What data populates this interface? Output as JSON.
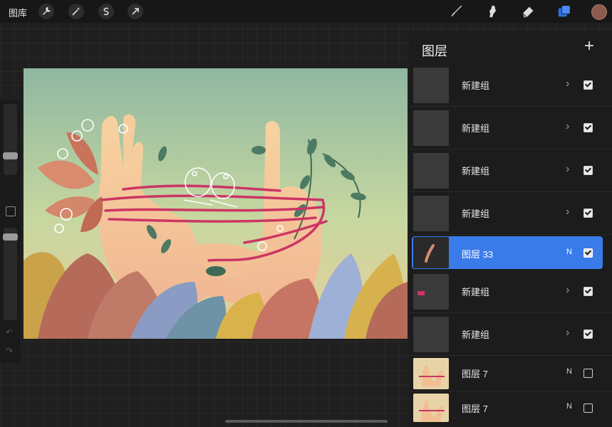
{
  "toolbar": {
    "gallery_label": "图库",
    "left_tools": [
      "wrench-icon",
      "magic-wand-icon",
      "selection-icon",
      "transform-arrow-icon"
    ],
    "right_tools": [
      "brush-icon",
      "smudge-icon",
      "eraser-icon",
      "layers-icon"
    ],
    "active_color": "#8c5a4e",
    "layers_accent": "#3a7bea"
  },
  "layers_panel": {
    "title": "图层",
    "add_label": "+",
    "items": [
      {
        "name": "新建组",
        "kind": "group",
        "visible": true
      },
      {
        "name": "新建组",
        "kind": "group",
        "visible": true
      },
      {
        "name": "新建组",
        "kind": "group",
        "visible": true
      },
      {
        "name": "新建组",
        "kind": "group",
        "visible": true
      },
      {
        "name": "图层 33",
        "kind": "layer",
        "blend": "N",
        "visible": true,
        "selected": true
      },
      {
        "name": "新建组",
        "kind": "group",
        "visible": true
      },
      {
        "name": "新建组",
        "kind": "group",
        "visible": true
      },
      {
        "name": "图层 7",
        "kind": "layer",
        "blend": "N",
        "visible": false
      },
      {
        "name": "图层 7",
        "kind": "layer",
        "blend": "N",
        "visible": false
      }
    ]
  }
}
